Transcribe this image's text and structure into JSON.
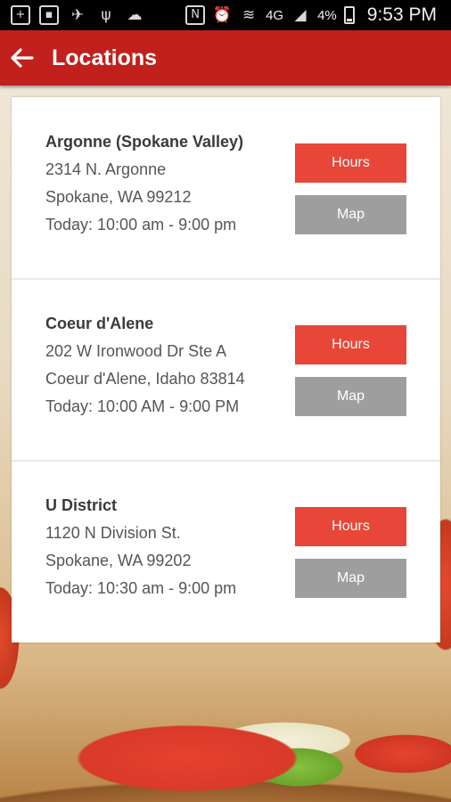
{
  "status_bar": {
    "battery": "4%",
    "time": "9:53 PM",
    "network": "4G"
  },
  "app_bar": {
    "title": "Locations"
  },
  "locations": [
    {
      "name": "Argonne (Spokane Valley)",
      "address1": "2314 N. Argonne",
      "address2": "Spokane, WA 99212",
      "hours_today": "Today: 10:00 am - 9:00 pm",
      "hours_button": "Hours",
      "map_button": "Map"
    },
    {
      "name": "Coeur d'Alene",
      "address1": "202 W Ironwood Dr Ste A",
      "address2": "Coeur d'Alene, Idaho 83814",
      "hours_today": "Today: 10:00 AM - 9:00 PM",
      "hours_button": "Hours",
      "map_button": "Map"
    },
    {
      "name": "U District",
      "address1": "1120 N Division St.",
      "address2": "Spokane, WA 99202",
      "hours_today": "Today: 10:30 am - 9:00 pm",
      "hours_button": "Hours",
      "map_button": "Map"
    }
  ],
  "colors": {
    "app_bar": "#c1201d",
    "hours_button": "#e84638",
    "map_button": "#9e9e9e"
  }
}
